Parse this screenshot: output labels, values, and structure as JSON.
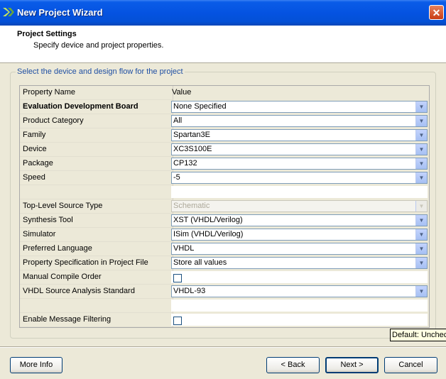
{
  "window": {
    "title": "New Project Wizard",
    "close_glyph": "✕"
  },
  "header": {
    "title": "Project Settings",
    "subtitle": "Specify device and project properties."
  },
  "group": {
    "label": "Select the device and design flow for the project"
  },
  "table": {
    "col_name": "Property Name",
    "col_value": "Value",
    "rows": [
      {
        "name": "Evaluation Development Board",
        "value": "None Specified",
        "type": "combo",
        "bold": true
      },
      {
        "name": "Product Category",
        "value": "All",
        "type": "combo"
      },
      {
        "name": "Family",
        "value": "Spartan3E",
        "type": "combo"
      },
      {
        "name": "Device",
        "value": "XC3S100E",
        "type": "combo"
      },
      {
        "name": "Package",
        "value": "CP132",
        "type": "combo"
      },
      {
        "name": "Speed",
        "value": "-5",
        "type": "combo"
      },
      {
        "name": "",
        "value": "",
        "type": "blank"
      },
      {
        "name": "Top-Level Source Type",
        "value": "Schematic",
        "type": "combo-disabled"
      },
      {
        "name": "Synthesis Tool",
        "value": "XST (VHDL/Verilog)",
        "type": "combo"
      },
      {
        "name": "Simulator",
        "value": "ISim (VHDL/Verilog)",
        "type": "combo"
      },
      {
        "name": "Preferred Language",
        "value": "VHDL",
        "type": "combo"
      },
      {
        "name": "Property Specification in Project File",
        "value": "Store all values",
        "type": "combo"
      },
      {
        "name": "Manual Compile Order",
        "value": "",
        "type": "checkbox",
        "checked": false
      },
      {
        "name": "VHDL Source Analysis Standard",
        "value": "VHDL-93",
        "type": "combo"
      },
      {
        "name": "",
        "value": "",
        "type": "blank"
      },
      {
        "name": "Enable Message Filtering",
        "value": "",
        "type": "checkbox",
        "checked": false
      }
    ]
  },
  "tooltip": {
    "text": "Default: Unchec"
  },
  "buttons": {
    "more_info": "More Info",
    "back": "< Back",
    "next": "Next >",
    "cancel": "Cancel"
  },
  "colors": {
    "title_bar": "#0553e1",
    "group_label": "#1f4fa3",
    "dialog_bg": "#ece9d8"
  }
}
